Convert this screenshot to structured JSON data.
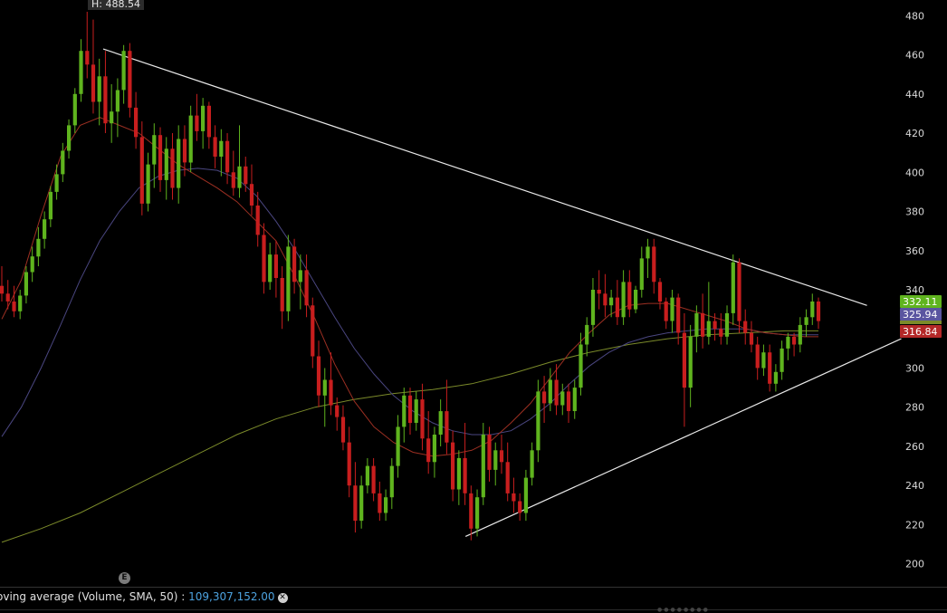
{
  "chart_data": {
    "type": "candlestick",
    "y_axis": {
      "ticks": [
        200,
        220,
        240,
        260,
        280,
        300,
        320,
        340,
        360,
        380,
        400,
        420,
        440,
        460,
        480
      ],
      "ylim": [
        192,
        488
      ]
    },
    "high_label": "H: 488.54",
    "earnings_marker": "E",
    "price_badges": [
      {
        "value": "332.11",
        "color": "#5fb41e"
      },
      {
        "value": "325.94",
        "color": "#5a55a0"
      },
      {
        "value": "316.84",
        "color": "#b42828"
      }
    ],
    "candles": [
      [
        342,
        352,
        334,
        338
      ],
      [
        338,
        345,
        330,
        334
      ],
      [
        334,
        342,
        326,
        329
      ],
      [
        329,
        340,
        325,
        337
      ],
      [
        337,
        352,
        333,
        349
      ],
      [
        349,
        362,
        344,
        357
      ],
      [
        357,
        372,
        352,
        366
      ],
      [
        366,
        380,
        361,
        376
      ],
      [
        376,
        393,
        372,
        390
      ],
      [
        390,
        404,
        386,
        399
      ],
      [
        399,
        415,
        395,
        411
      ],
      [
        411,
        427,
        407,
        424
      ],
      [
        424,
        443,
        420,
        440
      ],
      [
        440,
        468,
        436,
        462
      ],
      [
        462,
        482,
        448,
        455
      ],
      [
        455,
        478,
        430,
        436
      ],
      [
        436,
        458,
        424,
        449
      ],
      [
        449,
        462,
        420,
        425
      ],
      [
        425,
        445,
        415,
        431
      ],
      [
        431,
        448,
        418,
        442
      ],
      [
        442,
        465,
        435,
        462
      ],
      [
        462,
        466,
        428,
        433
      ],
      [
        433,
        441,
        412,
        418
      ],
      [
        418,
        426,
        378,
        384
      ],
      [
        384,
        410,
        380,
        404
      ],
      [
        404,
        425,
        392,
        419
      ],
      [
        419,
        423,
        390,
        396
      ],
      [
        396,
        418,
        386,
        412
      ],
      [
        412,
        420,
        386,
        392
      ],
      [
        392,
        424,
        384,
        417
      ],
      [
        417,
        424,
        398,
        405
      ],
      [
        405,
        434,
        400,
        429
      ],
      [
        429,
        440,
        416,
        421
      ],
      [
        421,
        438,
        412,
        434
      ],
      [
        434,
        436,
        412,
        418
      ],
      [
        418,
        424,
        402,
        408
      ],
      [
        408,
        422,
        398,
        416
      ],
      [
        416,
        420,
        394,
        400
      ],
      [
        400,
        411,
        388,
        392
      ],
      [
        392,
        424,
        387,
        403
      ],
      [
        403,
        408,
        390,
        394
      ],
      [
        394,
        404,
        378,
        383
      ],
      [
        383,
        390,
        362,
        368
      ],
      [
        368,
        374,
        338,
        344
      ],
      [
        344,
        364,
        340,
        358
      ],
      [
        358,
        365,
        336,
        346
      ],
      [
        346,
        352,
        320,
        329
      ],
      [
        329,
        368,
        324,
        362
      ],
      [
        362,
        366,
        338,
        344
      ],
      [
        344,
        358,
        330,
        350
      ],
      [
        350,
        358,
        326,
        332
      ],
      [
        332,
        336,
        300,
        306
      ],
      [
        306,
        314,
        280,
        286
      ],
      [
        286,
        300,
        270,
        294
      ],
      [
        294,
        308,
        276,
        281
      ],
      [
        281,
        285,
        268,
        275
      ],
      [
        275,
        281,
        258,
        262
      ],
      [
        262,
        270,
        234,
        240
      ],
      [
        240,
        252,
        216,
        222
      ],
      [
        222,
        245,
        218,
        240
      ],
      [
        240,
        254,
        236,
        250
      ],
      [
        250,
        254,
        232,
        236
      ],
      [
        236,
        242,
        222,
        226
      ],
      [
        226,
        238,
        222,
        234
      ],
      [
        234,
        254,
        228,
        250
      ],
      [
        250,
        276,
        244,
        270
      ],
      [
        270,
        290,
        262,
        286
      ],
      [
        286,
        290,
        266,
        272
      ],
      [
        272,
        288,
        268,
        284
      ],
      [
        284,
        292,
        258,
        264
      ],
      [
        264,
        278,
        246,
        252
      ],
      [
        252,
        270,
        244,
        266
      ],
      [
        266,
        284,
        260,
        278
      ],
      [
        278,
        294,
        256,
        262
      ],
      [
        262,
        268,
        232,
        238
      ],
      [
        238,
        258,
        230,
        254
      ],
      [
        254,
        272,
        230,
        236
      ],
      [
        236,
        240,
        212,
        218
      ],
      [
        218,
        238,
        214,
        234
      ],
      [
        234,
        272,
        230,
        266
      ],
      [
        266,
        270,
        242,
        248
      ],
      [
        248,
        262,
        240,
        258
      ],
      [
        258,
        266,
        246,
        252
      ],
      [
        252,
        262,
        232,
        236
      ],
      [
        236,
        244,
        226,
        232
      ],
      [
        232,
        236,
        222,
        226
      ],
      [
        226,
        248,
        222,
        244
      ],
      [
        244,
        262,
        240,
        258
      ],
      [
        258,
        294,
        252,
        288
      ],
      [
        288,
        296,
        272,
        282
      ],
      [
        282,
        300,
        278,
        294
      ],
      [
        294,
        302,
        276,
        281
      ],
      [
        281,
        292,
        276,
        288
      ],
      [
        288,
        292,
        272,
        278
      ],
      [
        278,
        294,
        274,
        290
      ],
      [
        290,
        318,
        286,
        312
      ],
      [
        312,
        326,
        306,
        322
      ],
      [
        322,
        346,
        316,
        340
      ],
      [
        340,
        350,
        330,
        338
      ],
      [
        338,
        348,
        326,
        332
      ],
      [
        332,
        340,
        326,
        336
      ],
      [
        336,
        345,
        322,
        326
      ],
      [
        326,
        350,
        322,
        344
      ],
      [
        344,
        350,
        326,
        330
      ],
      [
        330,
        342,
        328,
        340
      ],
      [
        340,
        362,
        336,
        356
      ],
      [
        356,
        366,
        346,
        362
      ],
      [
        362,
        366,
        338,
        344
      ],
      [
        344,
        346,
        330,
        334
      ],
      [
        334,
        336,
        320,
        324
      ],
      [
        324,
        340,
        318,
        336
      ],
      [
        336,
        338,
        312,
        318
      ],
      [
        318,
        328,
        270,
        290
      ],
      [
        290,
        322,
        280,
        316
      ],
      [
        316,
        332,
        308,
        328
      ],
      [
        328,
        338,
        310,
        316
      ],
      [
        316,
        344,
        312,
        324
      ],
      [
        324,
        328,
        314,
        320
      ],
      [
        320,
        328,
        312,
        316
      ],
      [
        316,
        332,
        312,
        328
      ],
      [
        328,
        358,
        322,
        354
      ],
      [
        354,
        356,
        318,
        324
      ],
      [
        324,
        330,
        312,
        318
      ],
      [
        318,
        324,
        308,
        312
      ],
      [
        312,
        316,
        294,
        300
      ],
      [
        300,
        312,
        296,
        308
      ],
      [
        308,
        312,
        288,
        292
      ],
      [
        292,
        302,
        288,
        298
      ],
      [
        298,
        314,
        294,
        310
      ],
      [
        310,
        318,
        304,
        316
      ],
      [
        316,
        318,
        306,
        312
      ],
      [
        312,
        326,
        308,
        322
      ],
      [
        322,
        330,
        316,
        326
      ],
      [
        326,
        338,
        322,
        334
      ],
      [
        334,
        336,
        320,
        324
      ]
    ],
    "sma_short": [
      [
        0,
        325
      ],
      [
        20,
        345
      ],
      [
        40,
        378
      ],
      [
        60,
        408
      ],
      [
        80,
        424
      ],
      [
        100,
        428
      ],
      [
        120,
        424
      ],
      [
        140,
        420
      ],
      [
        160,
        412
      ],
      [
        180,
        404
      ],
      [
        200,
        398
      ],
      [
        220,
        392
      ],
      [
        240,
        385
      ],
      [
        260,
        375
      ],
      [
        280,
        365
      ],
      [
        300,
        346
      ],
      [
        320,
        325
      ],
      [
        340,
        302
      ],
      [
        360,
        283
      ],
      [
        380,
        270
      ],
      [
        400,
        262
      ],
      [
        420,
        257
      ],
      [
        440,
        255
      ],
      [
        460,
        256
      ],
      [
        480,
        258
      ],
      [
        500,
        263
      ],
      [
        520,
        272
      ],
      [
        540,
        282
      ],
      [
        560,
        295
      ],
      [
        580,
        308
      ],
      [
        600,
        318
      ],
      [
        620,
        327
      ],
      [
        640,
        332
      ],
      [
        660,
        333
      ],
      [
        680,
        333
      ],
      [
        700,
        330
      ],
      [
        720,
        327
      ],
      [
        740,
        324
      ],
      [
        760,
        320
      ],
      [
        780,
        318
      ],
      [
        800,
        317
      ],
      [
        820,
        316
      ],
      [
        834,
        316
      ]
    ],
    "sma_medium": [
      [
        0,
        265
      ],
      [
        20,
        280
      ],
      [
        40,
        300
      ],
      [
        60,
        322
      ],
      [
        80,
        345
      ],
      [
        100,
        365
      ],
      [
        120,
        380
      ],
      [
        140,
        392
      ],
      [
        160,
        398
      ],
      [
        180,
        401
      ],
      [
        200,
        402
      ],
      [
        220,
        401
      ],
      [
        240,
        397
      ],
      [
        260,
        388
      ],
      [
        280,
        375
      ],
      [
        300,
        360
      ],
      [
        320,
        343
      ],
      [
        340,
        326
      ],
      [
        360,
        310
      ],
      [
        380,
        297
      ],
      [
        400,
        286
      ],
      [
        420,
        278
      ],
      [
        440,
        272
      ],
      [
        460,
        268
      ],
      [
        480,
        266
      ],
      [
        500,
        266
      ],
      [
        520,
        268
      ],
      [
        540,
        274
      ],
      [
        560,
        282
      ],
      [
        580,
        292
      ],
      [
        600,
        301
      ],
      [
        620,
        308
      ],
      [
        640,
        313
      ],
      [
        660,
        316
      ],
      [
        680,
        318
      ],
      [
        700,
        319
      ],
      [
        720,
        320
      ],
      [
        740,
        320
      ],
      [
        760,
        320
      ],
      [
        780,
        318
      ],
      [
        800,
        317
      ],
      [
        820,
        317
      ],
      [
        834,
        317
      ]
    ],
    "sma_long": [
      [
        0,
        211
      ],
      [
        40,
        218
      ],
      [
        80,
        226
      ],
      [
        120,
        236
      ],
      [
        160,
        246
      ],
      [
        200,
        256
      ],
      [
        240,
        266
      ],
      [
        280,
        274
      ],
      [
        320,
        280
      ],
      [
        360,
        284
      ],
      [
        400,
        287
      ],
      [
        440,
        289
      ],
      [
        480,
        292
      ],
      [
        520,
        297
      ],
      [
        560,
        303
      ],
      [
        600,
        308
      ],
      [
        640,
        312
      ],
      [
        680,
        315
      ],
      [
        720,
        317
      ],
      [
        760,
        318
      ],
      [
        800,
        319
      ],
      [
        834,
        319
      ]
    ],
    "trendlines": [
      {
        "from": [
          0,
          463
        ],
        "to": [
          780,
          332
        ]
      },
      {
        "from": [
          370,
          214
        ],
        "to": [
          815,
          315
        ]
      }
    ]
  },
  "volume_panel": {
    "label": "oving average (Volume, SMA, 50) :",
    "value": "109,307,152.00",
    "close_glyph": "✕"
  },
  "colors": {
    "up": "#5fb41e",
    "down": "#c81e1e",
    "background": "#000000"
  }
}
